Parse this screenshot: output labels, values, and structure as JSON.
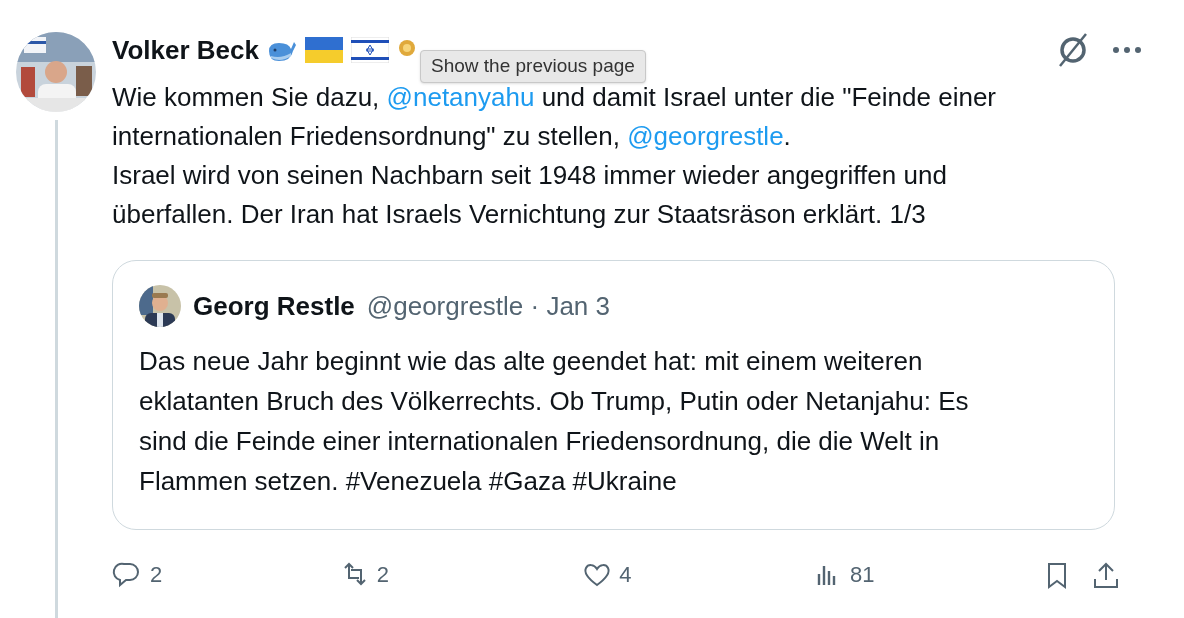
{
  "post": {
    "author": "Volker Beck",
    "tooltip": "Show the previous page",
    "paragraphs": [
      [
        {
          "kind": "text",
          "text": "Wie kommen Sie dazu, "
        },
        {
          "kind": "mention",
          "text": "@netanyahu"
        },
        {
          "kind": "text",
          "text": " und damit Israel unter die \"Feinde einer internationalen Friedensordnung\" zu stellen, "
        },
        {
          "kind": "mention",
          "text": "@georgrestle"
        },
        {
          "kind": "text",
          "text": "."
        }
      ],
      [
        {
          "kind": "text",
          "text": "Israel wird von seinen Nachbarn seit 1948 immer wieder angegriffen und überfallen. Der Iran hat Israels Vernichtung zur Staatsräson erklärt. 1/3"
        }
      ]
    ],
    "quote": {
      "author": "Georg Restle",
      "handle": "@georgrestle · Jan 3",
      "text": "Das neue Jahr beginnt wie das alte geendet hat: mit einem weiteren eklatanten Bruch des Völkerrechts. Ob Trump, Putin oder Netanjahu: Es sind die Feinde einer internationalen Friedensordnung, die die Welt in Flammen setzen. #Venezuela #Gaza #Ukraine"
    },
    "actions": [
      {
        "kind": "reply",
        "count": "2"
      },
      {
        "kind": "repost",
        "count": "2"
      },
      {
        "kind": "like",
        "count": "4"
      },
      {
        "kind": "views",
        "count": "81"
      },
      {
        "kind": "bookmark"
      },
      {
        "kind": "share"
      }
    ]
  }
}
